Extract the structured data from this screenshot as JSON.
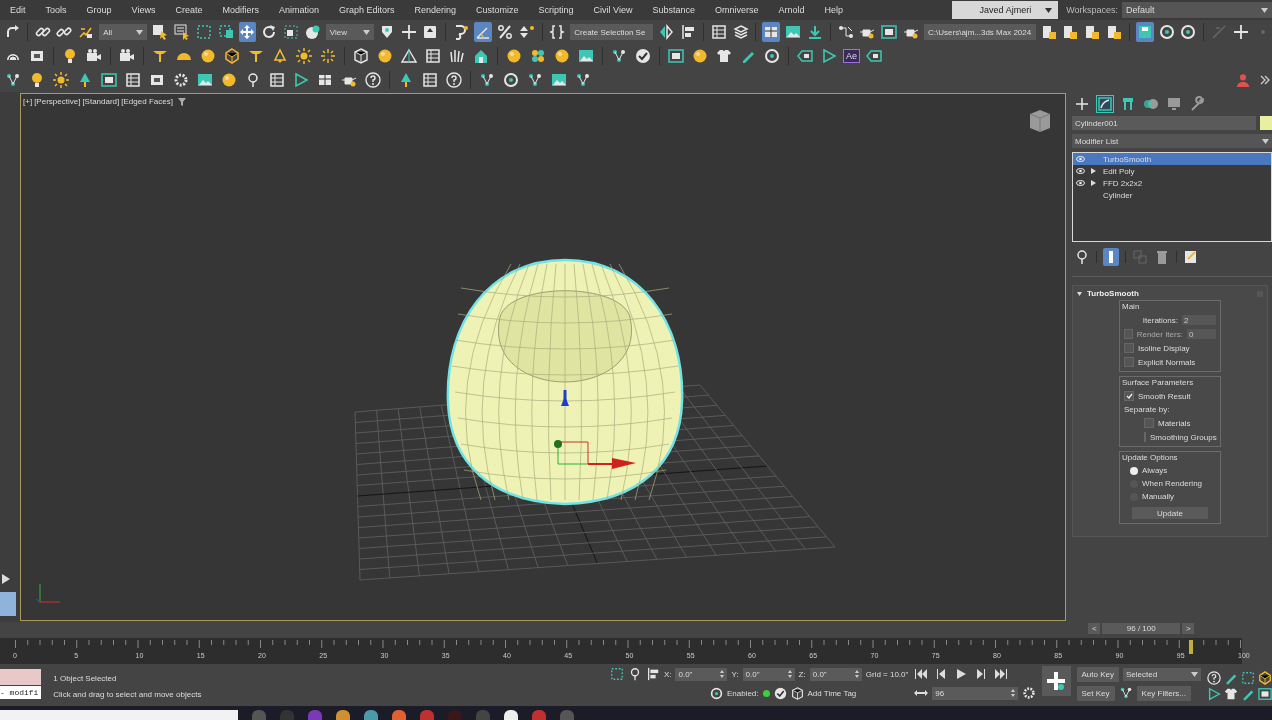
{
  "menu": [
    "Edit",
    "Tools",
    "Group",
    "Views",
    "Create",
    "Modifiers",
    "Animation",
    "Graph Editors",
    "Rendering",
    "Customize",
    "Scripting",
    "Civil View",
    "Substance",
    "Omniverse",
    "Arnold",
    "Help"
  ],
  "account": {
    "user": "Javed Ajmeri",
    "workspaces_label": "Workspaces:",
    "workspace": "Default"
  },
  "main_toolbar": [
    {
      "kind": "redo",
      "selected": false
    },
    {
      "kind": "sep"
    },
    {
      "kind": "link",
      "selected": false
    },
    {
      "kind": "unlink",
      "selected": false
    },
    {
      "kind": "bind",
      "selected": false
    },
    {
      "kind": "dropdown",
      "value": "All"
    },
    {
      "kind": "select",
      "selected": false
    },
    {
      "kind": "selectlist",
      "selected": false
    },
    {
      "kind": "rect",
      "selected": false
    },
    {
      "kind": "window",
      "selected": false
    },
    {
      "kind": "move",
      "selected": true
    },
    {
      "kind": "rotate",
      "selected": false
    },
    {
      "kind": "scale",
      "selected": false
    },
    {
      "kind": "place",
      "selected": false
    },
    {
      "kind": "dropdown",
      "value": "View"
    },
    {
      "kind": "pivot",
      "selected": false
    },
    {
      "kind": "plus",
      "selected": false
    },
    {
      "kind": "key",
      "selected": false
    },
    {
      "kind": "sep"
    },
    {
      "kind": "magnet",
      "selected": false
    },
    {
      "kind": "angle",
      "selected": true
    },
    {
      "kind": "percent",
      "selected": false
    },
    {
      "kind": "spinner",
      "selected": false
    },
    {
      "kind": "sep"
    },
    {
      "kind": "braces",
      "selected": false
    },
    {
      "kind": "dropdown",
      "value": "Create Selection Se"
    },
    {
      "kind": "mirror",
      "selected": false
    },
    {
      "kind": "align",
      "selected": false
    },
    {
      "kind": "sep"
    },
    {
      "kind": "table",
      "selected": false
    },
    {
      "kind": "layers",
      "selected": false
    },
    {
      "kind": "sep"
    },
    {
      "kind": "panels",
      "selected": true
    },
    {
      "kind": "image",
      "selected": false
    },
    {
      "kind": "download",
      "selected": false
    },
    {
      "kind": "sep"
    },
    {
      "kind": "graph",
      "selected": false
    },
    {
      "kind": "teapot",
      "selected": false
    },
    {
      "kind": "frame",
      "selected": false
    },
    {
      "kind": "teapot",
      "selected": false
    },
    {
      "kind": "dropdown",
      "value": "C:\\Users\\ajm...3ds Max 2024"
    },
    {
      "kind": "file",
      "selected": false
    },
    {
      "kind": "file",
      "selected": false
    },
    {
      "kind": "file",
      "selected": false
    },
    {
      "kind": "file",
      "selected": false
    },
    {
      "kind": "sep"
    },
    {
      "kind": "save",
      "selected": true
    },
    {
      "kind": "ring",
      "selected": false
    },
    {
      "kind": "ring",
      "selected": false
    },
    {
      "kind": "sep"
    },
    {
      "kind": "slash",
      "selected": false
    },
    {
      "kind": "plus",
      "selected": false
    },
    {
      "kind": "dot",
      "selected": false
    }
  ],
  "plugin_badge": "Ae",
  "viewport": {
    "labels": [
      "[+]",
      "[Perspective]",
      "[Standard]",
      "[Edged Faces]"
    ]
  },
  "command_panel": {
    "tabs": [
      {
        "kind": "create",
        "selected": false
      },
      {
        "kind": "modify",
        "selected": true
      },
      {
        "kind": "hierarchy",
        "selected": false
      },
      {
        "kind": "motion",
        "selected": false
      },
      {
        "kind": "display",
        "selected": false
      },
      {
        "kind": "utilities",
        "selected": false
      }
    ],
    "object_name": "Cylinder001",
    "modifier_list": "Modifier List",
    "stack": [
      {
        "label": "TurboSmooth",
        "visible": true,
        "expandable": false,
        "selected": true
      },
      {
        "label": "Edit Poly",
        "visible": true,
        "expandable": true,
        "selected": false
      },
      {
        "label": "FFD 2x2x2",
        "visible": true,
        "expandable": true,
        "selected": false
      },
      {
        "label": "Cylinder",
        "visible": false,
        "expandable": false,
        "selected": false
      }
    ],
    "stack_tools": [
      {
        "kind": "pin",
        "selected": false
      },
      {
        "kind": "sep"
      },
      {
        "kind": "endresult",
        "selected": true
      },
      {
        "kind": "sep"
      },
      {
        "kind": "unique",
        "selected": false
      },
      {
        "kind": "trash",
        "selected": false
      },
      {
        "kind": "sep"
      },
      {
        "kind": "config",
        "selected": false
      }
    ],
    "rollout": {
      "title": "TurboSmooth",
      "main": {
        "title": "Main",
        "iterations": {
          "label": "Iterations:",
          "value": "2"
        },
        "render_iters": {
          "label": "Render Iters:",
          "value": "0",
          "checked": false
        },
        "options": [
          {
            "label": "Isoline Display",
            "checked": false
          },
          {
            "label": "Explicit Normals",
            "checked": false
          }
        ]
      },
      "surface": {
        "title": "Surface Parameters",
        "smooth_result": {
          "label": "Smooth Result",
          "checked": true
        },
        "separate_label": "Separate by:",
        "separate": [
          {
            "label": "Materials",
            "checked": false
          },
          {
            "label": "Smoothing Groups",
            "checked": false
          }
        ]
      },
      "update": {
        "title": "Update Options",
        "options": [
          {
            "label": "Always",
            "selected": true
          },
          {
            "label": "When Rendering",
            "selected": false
          },
          {
            "label": "Manually",
            "selected": false
          }
        ],
        "button": "Update"
      }
    }
  },
  "timeline": {
    "prev": "<",
    "counter": "96 / 100",
    "next": ">",
    "level": 0.96,
    "ticks": [
      "0",
      "5",
      "10",
      "15",
      "20",
      "25",
      "30",
      "35",
      "40",
      "45",
      "50",
      "55",
      "60",
      "65",
      "70",
      "75",
      "80",
      "85",
      "90",
      "95",
      "100"
    ]
  },
  "status": {
    "script_output": "- modifi",
    "lines": [
      "1 Object Selected",
      "Click and drag to select and move objects"
    ],
    "coords": [
      {
        "axis": "X:",
        "value": "0.0\""
      },
      {
        "axis": "Y:",
        "value": "0.0\""
      },
      {
        "axis": "Z:",
        "value": "0.0\""
      }
    ],
    "grid": "Grid = 10.0\"",
    "enabled_label": "Enabled:",
    "time_tag": "Add Time Tag",
    "frame": "96",
    "auto_key": "Auto Key",
    "key_mode": "Selected",
    "set_key": "Set Key",
    "key_filters": "Key Filters..."
  }
}
